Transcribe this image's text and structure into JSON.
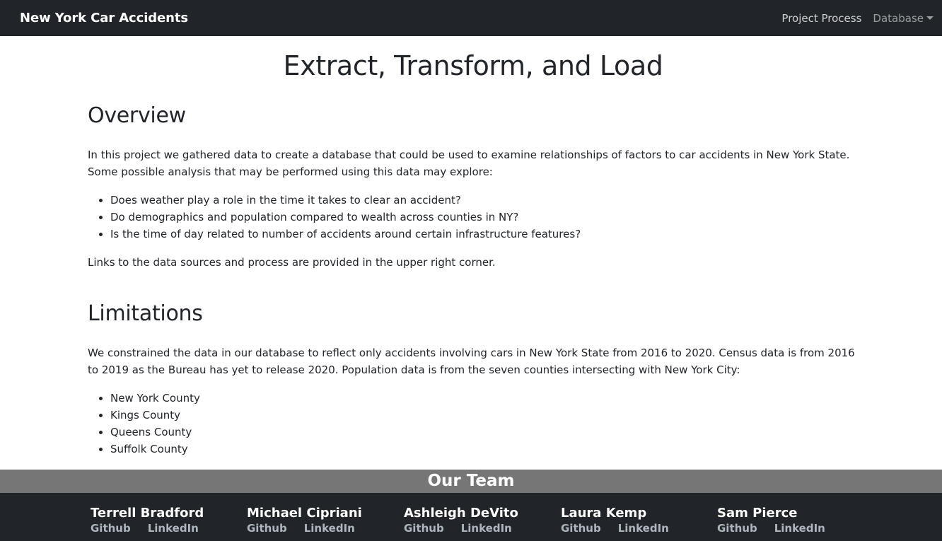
{
  "navbar": {
    "brand": "New York Car Accidents",
    "links": [
      {
        "label": "Project Process"
      },
      {
        "label": "Database"
      }
    ]
  },
  "main": {
    "title": "Extract, Transform, and Load",
    "overview": {
      "heading": "Overview",
      "intro": "In this project we gathered data to create a database that could be used to examine relationships of factors to car accidents in New York State. Some possible analysis that may be performed using this data may explore:",
      "questions": [
        "Does weather play a role in the time it takes to clear an accident?",
        "Do demographics and population compared to wealth across counties in NY?",
        "Is the time of day related to number of accidents around certain infrastructure features?"
      ],
      "links_note": "Links to the data sources and process are provided in the upper right corner."
    },
    "limitations": {
      "heading": "Limitations",
      "text": "We constrained the data in our database to reflect only accidents involving cars in New York State from 2016 to 2020. Census data is from 2016 to 2019 as the Bureau has yet to release 2020. Population data is from the seven counties intersecting with New York City:",
      "counties": [
        "New York County",
        "Kings County",
        "Queens County",
        "Suffolk County"
      ]
    }
  },
  "team": {
    "title": "Our Team",
    "members": [
      {
        "name": "Terrell Bradford",
        "github": "Github",
        "linkedin": "LinkedIn"
      },
      {
        "name": "Michael Cipriani",
        "github": "Github",
        "linkedin": "LinkedIn"
      },
      {
        "name": "Ashleigh DeVito",
        "github": "Github",
        "linkedin": "LinkedIn"
      },
      {
        "name": "Laura Kemp",
        "github": "Github",
        "linkedin": "LinkedIn"
      },
      {
        "name": "Sam Pierce",
        "github": "Github",
        "linkedin": "LinkedIn"
      }
    ]
  }
}
